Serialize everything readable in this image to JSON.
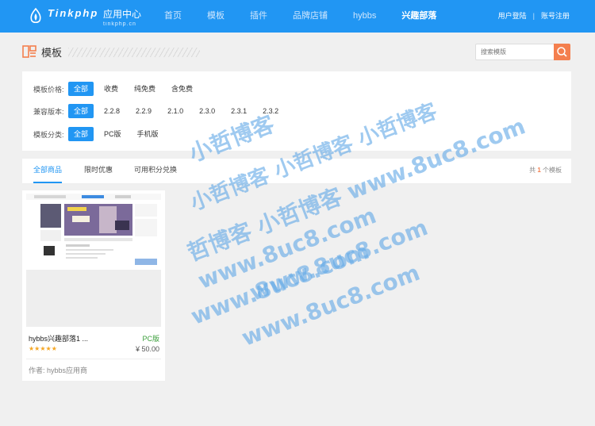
{
  "header": {
    "logo_name": "Tinkphp",
    "logo_subtitle": "应用中心",
    "logo_domain": "tinkphp.cn",
    "nav": [
      {
        "label": "首页",
        "active": false
      },
      {
        "label": "模板",
        "active": false
      },
      {
        "label": "插件",
        "active": false
      },
      {
        "label": "品牌店铺",
        "active": false
      },
      {
        "label": "hybbs",
        "active": false
      },
      {
        "label": "兴趣部落",
        "active": true
      }
    ],
    "login": "用户登陆",
    "separator": "|",
    "register": "账号注册"
  },
  "page": {
    "title": "模板",
    "search_placeholder": "搜索模版"
  },
  "filters": {
    "price": {
      "label": "模板价格:",
      "options": [
        "全部",
        "收费",
        "纯免费",
        "含免费"
      ],
      "active_index": 0
    },
    "version": {
      "label": "兼容版本:",
      "options": [
        "全部",
        "2.2.8",
        "2.2.9",
        "2.1.0",
        "2.3.0",
        "2.3.1",
        "2.3.2"
      ],
      "active_index": 0
    },
    "category": {
      "label": "模板分类:",
      "options": [
        "全部",
        "PC版",
        "手机版"
      ],
      "active_index": 0
    }
  },
  "tabs": [
    {
      "label": "全部商品",
      "active": true
    },
    {
      "label": "限时优惠",
      "active": false
    },
    {
      "label": "可用积分兑换",
      "active": false
    }
  ],
  "result_count": {
    "prefix": "共",
    "value": "1",
    "suffix": "个模板"
  },
  "products": [
    {
      "title": "hybbs兴趣部落1 ...",
      "tag": "PC版",
      "rating": 5,
      "stars": "★★★★★",
      "price": "¥ 50.00",
      "author_label": "作者:",
      "author": "hybbs应用商"
    }
  ],
  "watermark": {
    "line1": "小哲博客",
    "line2": "小哲博客 小哲博客 小哲博客",
    "line3": "哲博客 小哲博客 www.8uc8.com",
    "line4": "www.8uc8.com",
    "line5": "www.8uc8.com",
    "line6": "www.8uc8.com",
    "line7": "www.8uc8.com"
  },
  "colors": {
    "brand": "#2196f3",
    "accent": "#f47f4e",
    "tag_green": "#3a9e3a",
    "star": "#f5a623"
  }
}
